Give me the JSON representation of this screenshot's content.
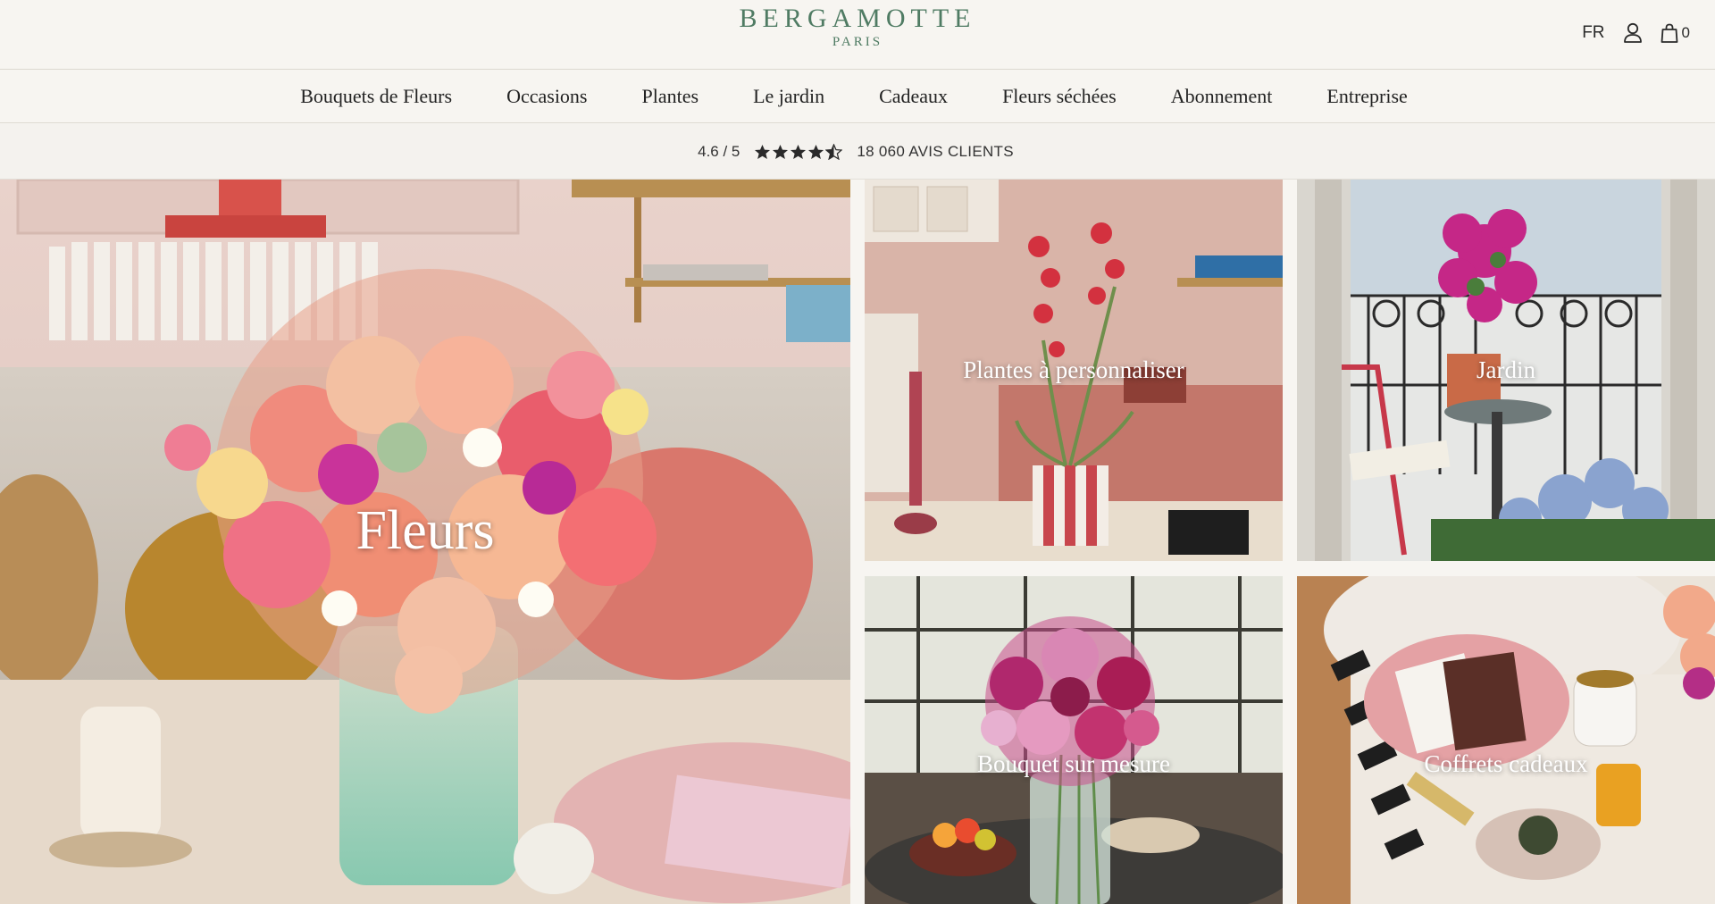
{
  "header": {
    "brand_name": "BERGAMOTTE",
    "brand_city": "PARIS",
    "language": "FR",
    "cart_count": "0",
    "icons": [
      "user-icon",
      "bag-icon"
    ]
  },
  "nav": {
    "items": [
      {
        "label": "Bouquets de Fleurs"
      },
      {
        "label": "Occasions"
      },
      {
        "label": "Plantes"
      },
      {
        "label": "Le jardin"
      },
      {
        "label": "Cadeaux"
      },
      {
        "label": "Fleurs séchées"
      },
      {
        "label": "Abonnement"
      },
      {
        "label": "Entreprise"
      }
    ]
  },
  "rating": {
    "score": "4.6 / 5",
    "stars_value": 4.5,
    "stars_max": 5,
    "count": "18 060 AVIS CLIENTS"
  },
  "tiles": {
    "fleurs": {
      "label": "Fleurs"
    },
    "plantes": {
      "label": "Plantes à personnaliser"
    },
    "jardin": {
      "label": "Jardin"
    },
    "bouquet": {
      "label": "Bouquet sur mesure"
    },
    "coffrets": {
      "label": "Coffrets cadeaux"
    }
  },
  "colors": {
    "brand_green": "#4f7b63",
    "background": "#f7f5f1",
    "text": "#2a2a2a"
  }
}
